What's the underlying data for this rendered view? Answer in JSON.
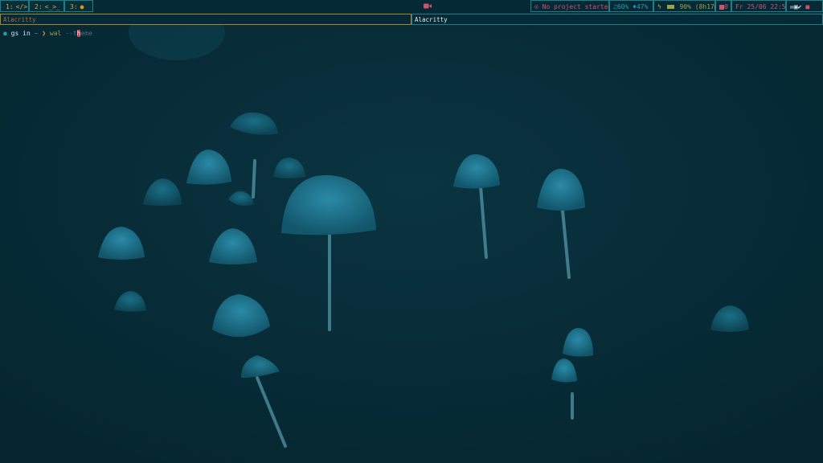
{
  "topbar": {
    "workspaces": [
      {
        "label": "1:",
        "icon": "code-icon",
        "glyph": "</>"
      },
      {
        "label": "2:",
        "icon": "terminal-icon",
        "glyph": "<_>_"
      },
      {
        "label": "3:",
        "icon": "firefox-icon",
        "glyph": "●"
      }
    ],
    "record_icon": "video-camera-icon",
    "timer": "No project started.",
    "audio": {
      "volume": "60%",
      "mic": "47%"
    },
    "battery": "90% (8h17m)",
    "notifications": "0",
    "date": "Fr 25/06 22:51"
  },
  "window": {
    "left_title": "Alacritty",
    "right_title": "Alacritty"
  },
  "terminal": {
    "prompt_user": "gs",
    "prompt_in": "in",
    "prompt_dir": "~",
    "prompt_arrow": "❯",
    "command": "wal",
    "arg_before_cursor": "--t",
    "cursor_char": "h",
    "arg_after_cursor": "eme"
  },
  "colors": {
    "background": "#062c37",
    "accent_cyan": "#1a7f86",
    "accent_yellow": "#c9a84a",
    "accent_red": "#c9546b",
    "accent_green": "#9aa34a"
  }
}
